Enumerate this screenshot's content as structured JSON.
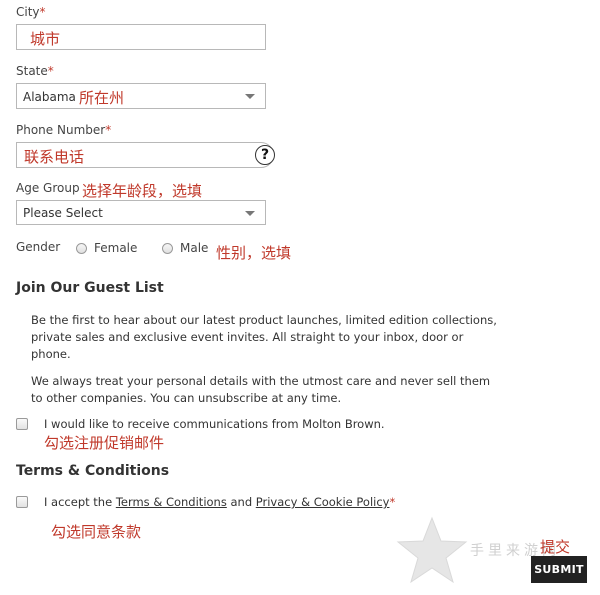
{
  "city": {
    "label": "City",
    "required": "*",
    "value": "城市"
  },
  "state": {
    "label": "State",
    "required": "*",
    "selected": "Alabama",
    "annotation": "所在州"
  },
  "phone": {
    "label": "Phone Number",
    "required": "*",
    "value": "联系电话",
    "help_icon": "?"
  },
  "age": {
    "label": "Age Group",
    "annotation": "选择年龄段，选填",
    "selected": "Please Select"
  },
  "gender": {
    "label": "Gender",
    "female": "Female",
    "male": "Male",
    "annotation": "性别，选填"
  },
  "guest": {
    "title": "Join Our Guest List",
    "para1_line1": "Be the first to hear about our latest product launches, limited edition collections,",
    "para1_line2": "private sales and exclusive event invites. All straight to your inbox, door or",
    "para1_line3": "phone.",
    "para2_line1": "We always treat your personal details with the utmost care and never sell them",
    "para2_line2": "to other companies. You can unsubscribe at any time.",
    "checkbox_label": "I would like to receive communications from Molton Brown.",
    "annotation": "勾选注册促销邮件"
  },
  "terms": {
    "title": "Terms & Conditions",
    "accept_prefix": "I accept the ",
    "terms_link": "Terms & Conditions",
    "and": " and ",
    "privacy_link": "Privacy & Cookie Policy",
    "required": "*",
    "annotation": "勾选同意条款"
  },
  "submit": {
    "label": "SUBMIT",
    "annotation": "提交"
  },
  "watermark": {
    "text": "手里来游网"
  },
  "colors": {
    "annotation": "#c0392b",
    "submit_bg": "#222222"
  }
}
